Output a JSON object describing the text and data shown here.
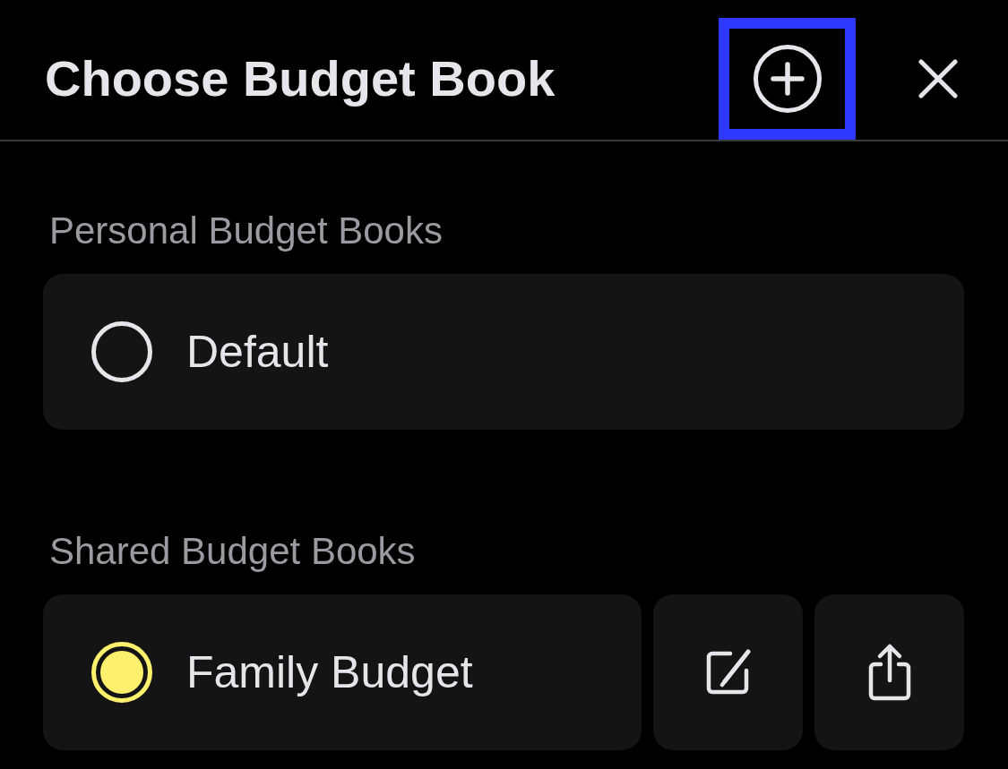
{
  "header": {
    "title": "Choose Budget Book",
    "add_button": {
      "highlighted": true
    }
  },
  "sections": [
    {
      "heading": "Personal Budget Books",
      "books": [
        {
          "name": "Default",
          "selected": false
        }
      ]
    },
    {
      "heading": "Shared Budget Books",
      "books": [
        {
          "name": "Family Budget",
          "selected": true,
          "actions": [
            {
              "kind": "edit"
            },
            {
              "kind": "share"
            }
          ]
        }
      ]
    }
  ]
}
